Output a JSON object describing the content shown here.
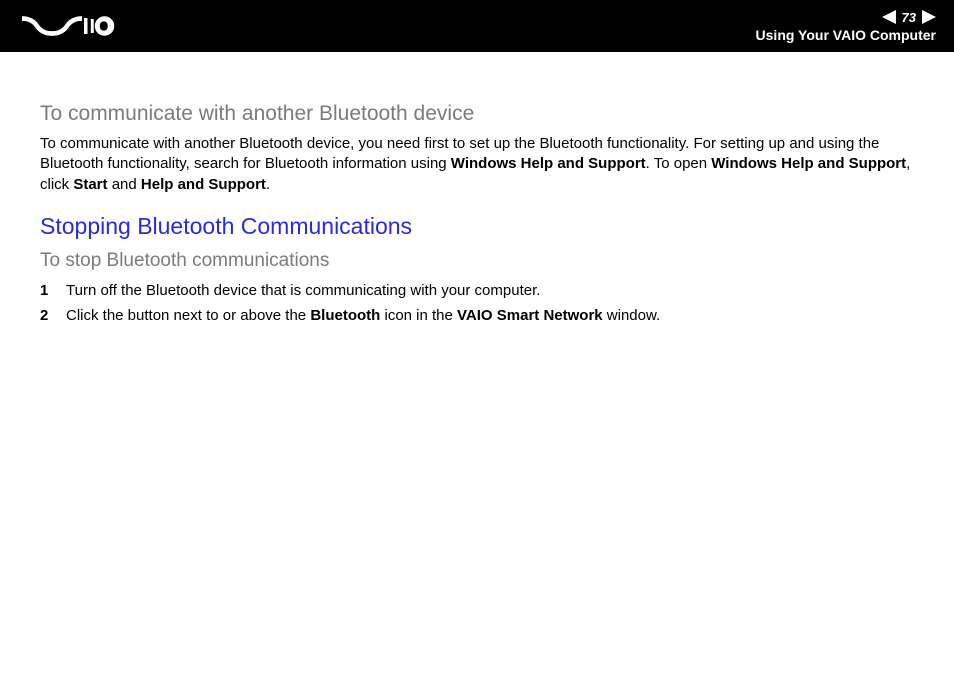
{
  "header": {
    "page_number": "73",
    "breadcrumb": "Using Your VAIO Computer"
  },
  "section1": {
    "heading": "To communicate with another Bluetooth device",
    "para_parts": {
      "p1": "To communicate with another Bluetooth device, you need first to set up the Bluetooth functionality. For setting up and using the Bluetooth functionality, search for Bluetooth information using ",
      "b1": "Windows Help and Support",
      "p2": ". To open ",
      "b2": "Windows Help and Support",
      "p3": ", click ",
      "b3": "Start",
      "p4": " and ",
      "b4": "Help and Support",
      "p5": "."
    }
  },
  "section2": {
    "heading_main": "Stopping Bluetooth Communications",
    "heading_sub": "To stop Bluetooth communications",
    "steps": {
      "s1_num": "1",
      "s1_text": "Turn off the Bluetooth device that is communicating with your computer.",
      "s2_num": "2",
      "s2_p1": "Click the button next to or above the ",
      "s2_b1": "Bluetooth",
      "s2_p2": " icon in the ",
      "s2_b2": "VAIO Smart Network",
      "s2_p3": " window."
    }
  }
}
